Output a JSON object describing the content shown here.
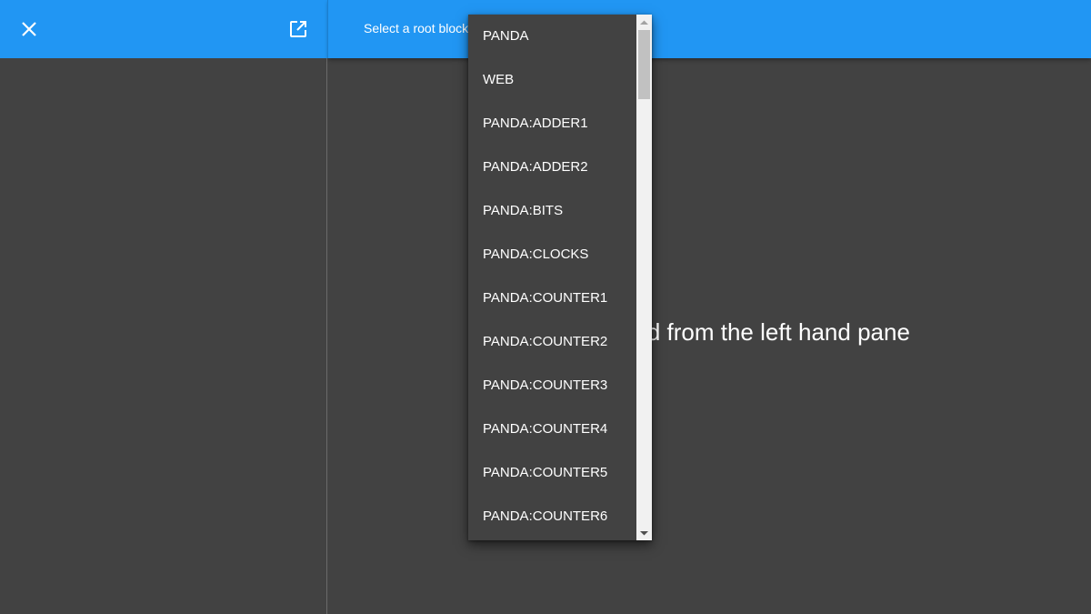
{
  "header": {
    "close_icon": "close-icon",
    "popout_icon": "open-in-new-icon",
    "root_block_label": "Select a root block",
    "accent_color": "#2196f3"
  },
  "main": {
    "message": "e select a field from the left hand pane"
  },
  "dropdown": {
    "items": [
      "PANDA",
      "WEB",
      "PANDA:ADDER1",
      "PANDA:ADDER2",
      "PANDA:BITS",
      "PANDA:CLOCKS",
      "PANDA:COUNTER1",
      "PANDA:COUNTER2",
      "PANDA:COUNTER3",
      "PANDA:COUNTER4",
      "PANDA:COUNTER5",
      "PANDA:COUNTER6"
    ],
    "background_color": "#424242"
  }
}
